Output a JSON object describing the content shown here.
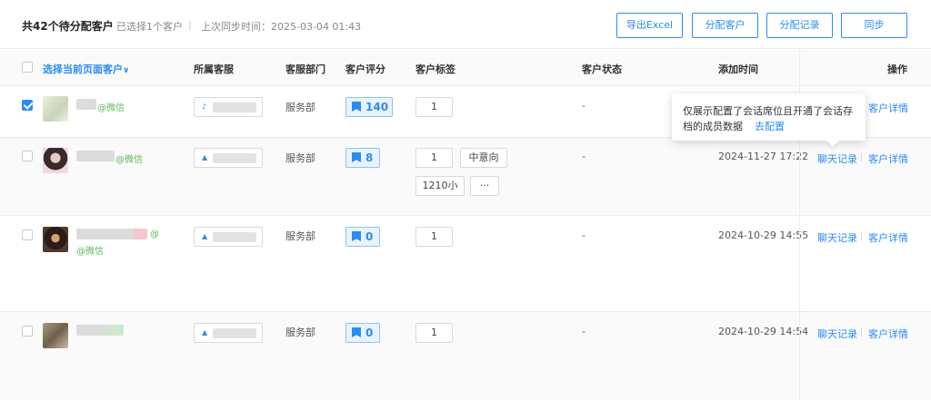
{
  "toolbar": {
    "summary": "共42个待分配客户",
    "selected": "已选择1个客户",
    "separator": "|",
    "sync_time": "上次同步时间：2025-03-04 01:43",
    "export_label": "导出Excel",
    "assign_label": "分配客户",
    "assign_records_label": "分配记录",
    "sync_label": "同步"
  },
  "table": {
    "columns": {
      "select_page": "选择当前页面客户",
      "agent": "所属客服",
      "dept": "客服部门",
      "score": "客户评分",
      "tags": "客户标签",
      "status": "客户状态",
      "added": "添加时间",
      "ops": "操作"
    },
    "rows": [
      {
        "checked": true,
        "wechat": "@微信",
        "dept": "服务部",
        "score": "140",
        "tags": [
          "1"
        ],
        "status": "-",
        "added": "",
        "chat_link": "",
        "detail_link": "客户详情"
      },
      {
        "checked": false,
        "wechat": "@微信",
        "dept": "服务部",
        "score": "8",
        "tags": [
          "1",
          "中意向",
          "1210小",
          "···"
        ],
        "status": "-",
        "added": "2024-11-27 17:22",
        "chat_link": "聊天记录",
        "detail_link": "客户详情"
      },
      {
        "checked": false,
        "wechat": "@微信",
        "dept": "服务部",
        "score": "0",
        "tags": [
          "1"
        ],
        "status": "-",
        "added": "2024-10-29 14:55",
        "chat_link": "聊天记录",
        "detail_link": "客户详情"
      },
      {
        "checked": false,
        "wechat": "",
        "dept": "服务部",
        "score": "0",
        "tags": [
          "1"
        ],
        "status": "-",
        "added": "2024-10-29 14:54",
        "chat_link": "聊天记录",
        "detail_link": "客户详情"
      }
    ]
  },
  "tooltip": {
    "line1": "仅展示配置了会话席位且开通了会话存",
    "line2": "档的成员数据",
    "action": "去配置"
  },
  "colors": {
    "accent": "#2b8cf2",
    "wechat": "#5cb85c"
  }
}
